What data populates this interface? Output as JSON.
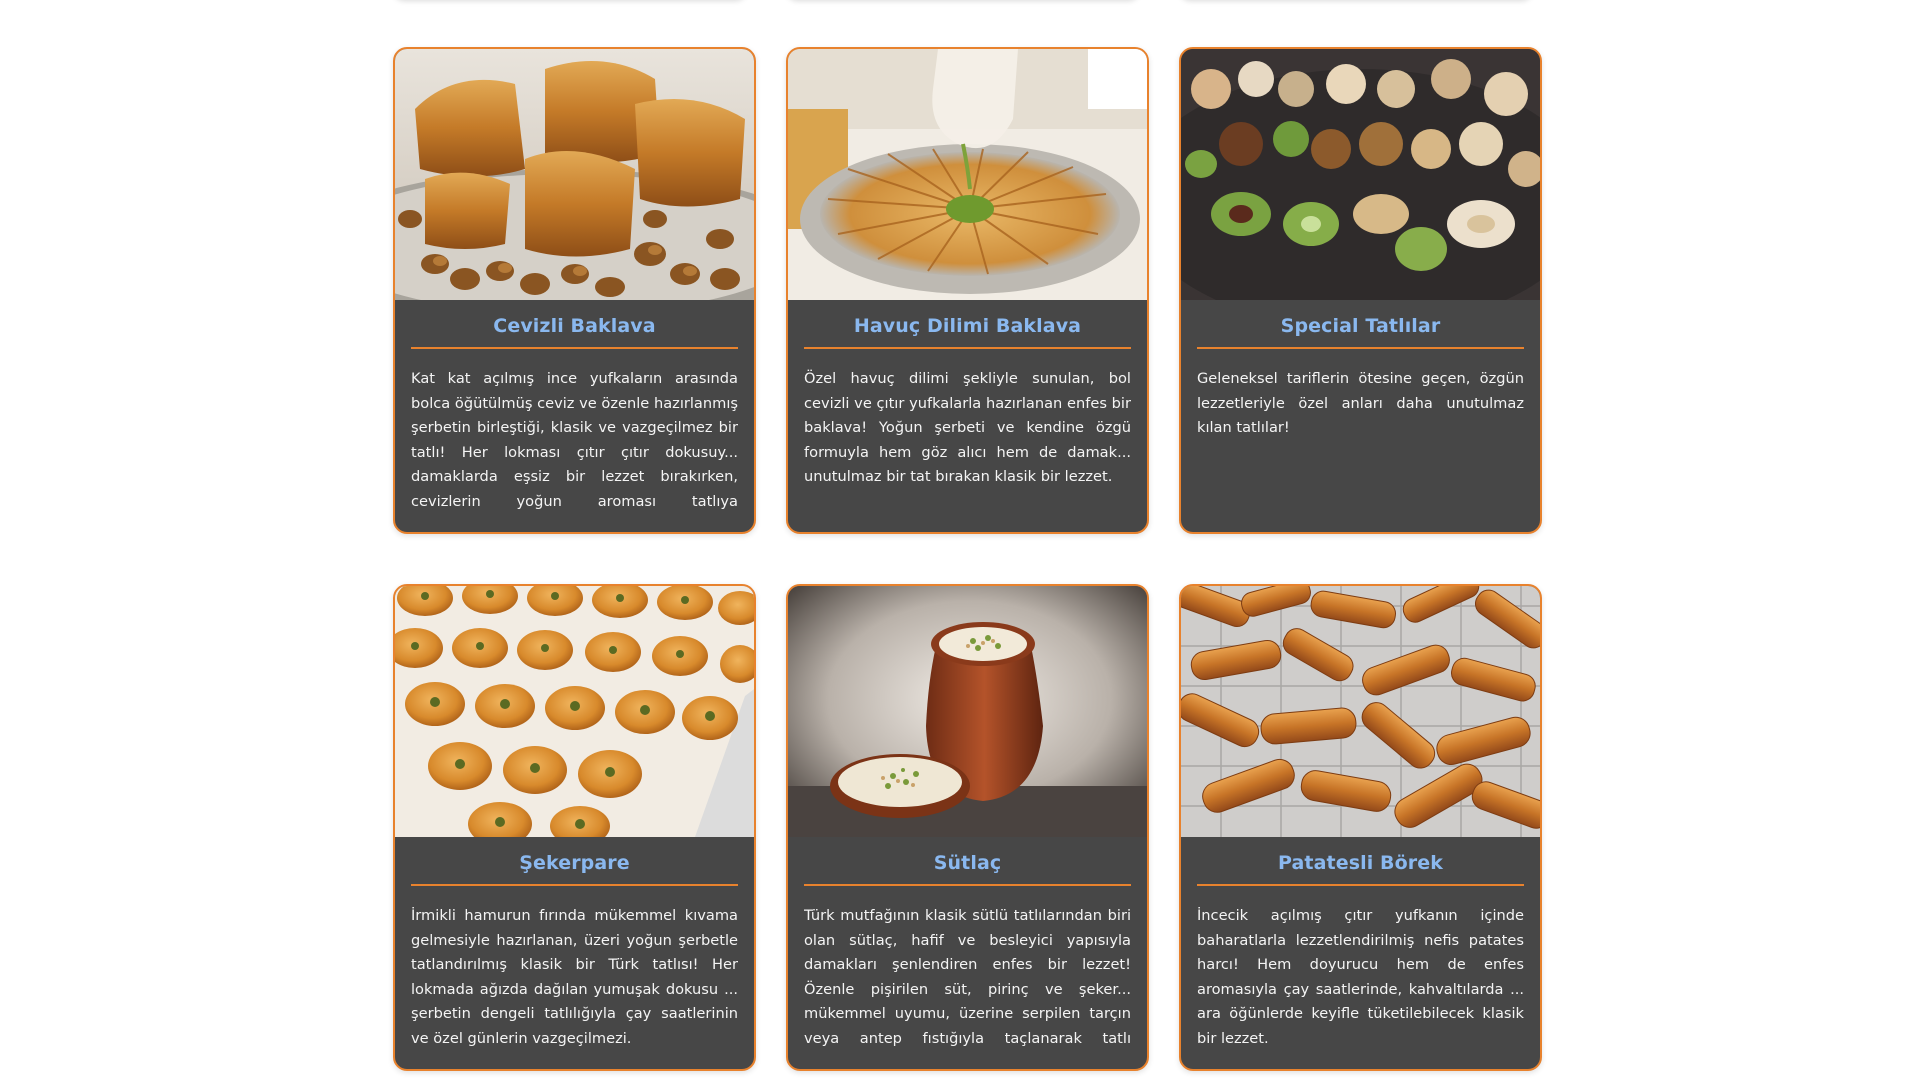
{
  "cards": [
    {
      "title": "Cevizli Baklava",
      "description": "Kat kat açılmış ince yufkaların arasında bolca öğütülmüş ceviz ve özenle hazırlanmış şerbetin birleştiği, klasik ve vazgeçilmez bir tatlı! Her lokması çıtır çıtır dokusuy... damaklarda eşsiz bir lezzet bırakırken, cevizlerin yoğun aroması tatlıya karakteristik"
    },
    {
      "title": "Havuç Dilimi Baklava",
      "description": "Özel havuç dilimi şekliyle sunulan, bol cevizli ve çıtır yufkalarla hazırlanan enfes bir baklava! Yoğun şerbeti ve kendine özgü formuyla hem göz alıcı hem de damak... unutulmaz bir tat bırakan klasik bir lezzet."
    },
    {
      "title": "Special Tatlılar",
      "description": "Geleneksel tariflerin ötesine geçen, özgün lezzetleriyle özel anları daha unutulmaz kılan tatlılar!"
    },
    {
      "title": "Şekerpare",
      "description": "İrmikli hamurun fırında mükemmel kıvama gelmesiyle hazırlanan, üzeri yoğun şerbetle tatlandırılmış klasik bir Türk tatlısı! Her lokmada ağızda dağılan yumuşak dokusu ... şerbetin dengeli tatlılığıyla çay saatlerinin ve özel günlerin vazgeçilmezi."
    },
    {
      "title": "Sütlaç",
      "description": "Türk mutfağının klasik sütlü tatlılarından biri olan sütlaç, hafif ve besleyici yapısıyla damakları şenlendiren enfes bir lezzet! Özenle pişirilen süt, pirinç ve şeker... mükemmel uyumu, üzerine serpilen tarçın veya antep fıstığıyla taçlanarak tatlı krizlerine"
    },
    {
      "title": "Patatesli Börek",
      "description": "İncecik açılmış çıtır yufkanın içinde baharatlarla lezzetlendirilmiş nefis patates harcı! Hem doyurucu hem de enfes aromasıyla çay saatlerinde, kahvaltılarda ... ara öğünlerde keyifle tüketilebilecek klasik bir lezzet."
    }
  ],
  "colors": {
    "card_background": "#474747",
    "card_border": "#e8822d",
    "title_text": "#8ab8ef",
    "body_text": "#f4f4f4"
  }
}
